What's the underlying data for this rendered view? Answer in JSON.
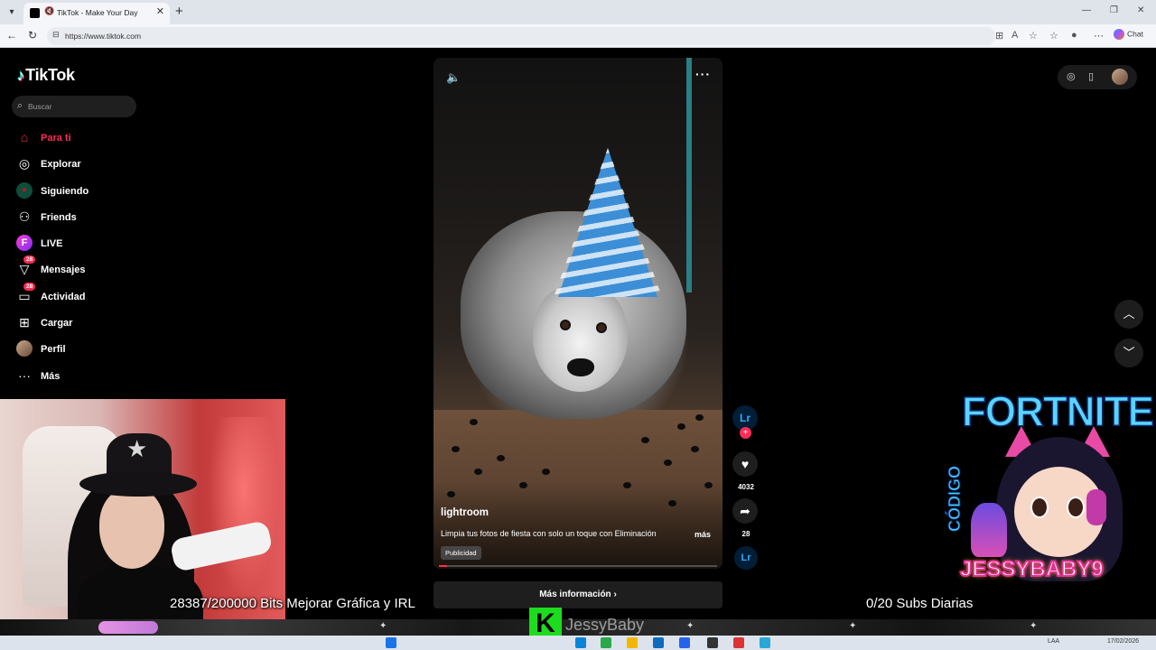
{
  "browser": {
    "tab_title": "TikTok - Make Your Day",
    "url": "https://www.tiktok.com",
    "chat_label": "Chat"
  },
  "sidebar": {
    "brand": "TikTok",
    "search_placeholder": "Buscar",
    "items": [
      {
        "label": "Para ti",
        "icon": "home-icon",
        "active": true
      },
      {
        "label": "Explorar",
        "icon": "compass-icon"
      },
      {
        "label": "Siguiendo",
        "icon": "following-avatar-icon"
      },
      {
        "label": "Friends",
        "icon": "friends-icon"
      },
      {
        "label": "LIVE",
        "icon": "live-icon"
      },
      {
        "label": "Mensajes",
        "icon": "messages-icon",
        "badge": "28"
      },
      {
        "label": "Actividad",
        "icon": "activity-icon",
        "badge": "28"
      },
      {
        "label": "Cargar",
        "icon": "upload-icon"
      },
      {
        "label": "Perfil",
        "icon": "profile-avatar-icon"
      },
      {
        "label": "Más",
        "icon": "more-dots-icon"
      }
    ]
  },
  "video": {
    "author": "lightroom",
    "description": "Limpia tus fotos de fiesta con solo un toque con Eliminación",
    "more_label": "más",
    "ad_label": "Publicidad",
    "cta_label": "Más información",
    "progress": 0.03
  },
  "actions": {
    "avatar_text": "Lr",
    "likes": "4032",
    "shares": "28",
    "disc_text": "Lr"
  },
  "overlay": {
    "bits_goal": "28387/200000 Bits Mejorar Gráfica y IRL",
    "subs_goal": "0/20 Subs Diarias",
    "channel_name": "JessyBaby",
    "k_letter": "K",
    "promo_title": "FORTNITE",
    "promo_code_label": "CÓDIGO",
    "promo_code": "JESSYBABY9"
  },
  "taskbar": {
    "lang": "LAA",
    "date": "17/02/2026"
  },
  "colors": {
    "accent": "#fe2c55",
    "lightroom": "#31a8ff"
  }
}
